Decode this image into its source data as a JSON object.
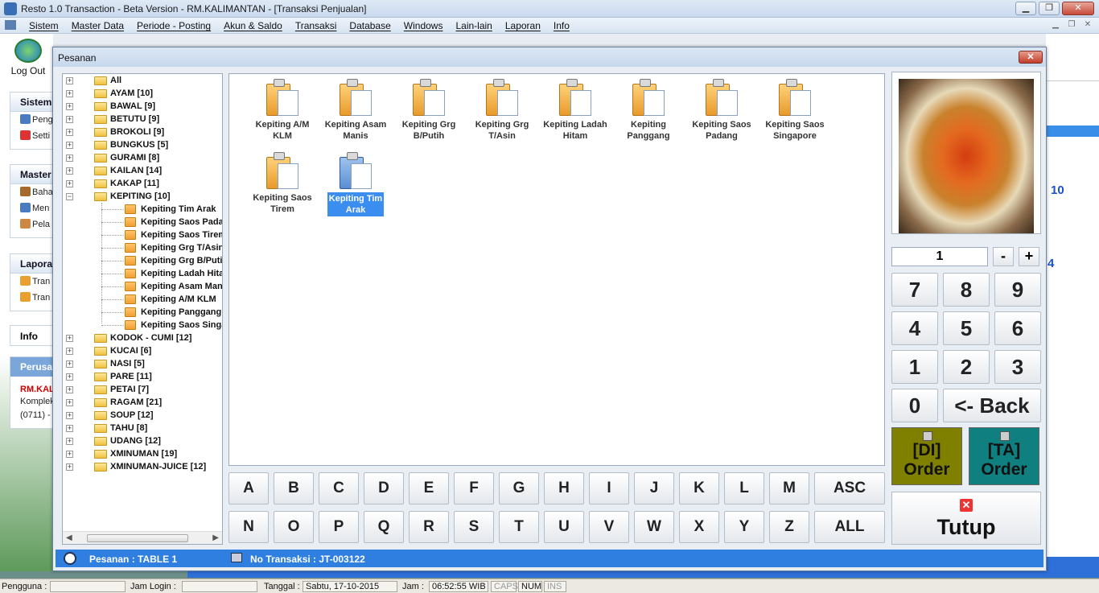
{
  "window": {
    "title": "Resto 1.0 Transaction - Beta Version - RM.KALIMANTAN - [Transaksi Penjualan]"
  },
  "menu": [
    "Sistem",
    "Master Data",
    "Periode - Posting",
    "Akun & Saldo",
    "Transaksi",
    "Database",
    "Windows",
    "Lain-lain",
    "Laporan",
    "Info"
  ],
  "sidebar": {
    "logout_label": "Log Out",
    "sistem": {
      "title": "Sistem",
      "items": [
        "Peng",
        "Setti"
      ]
    },
    "master": {
      "title": "Master",
      "items": [
        "Baha",
        "Men",
        "Pela"
      ]
    },
    "laporan": {
      "title": "Laporan",
      "items": [
        "Tran",
        "Tran"
      ]
    },
    "info_title": "Info",
    "perusahaan": {
      "title": "Perusa",
      "company": "RM.KALIMANTAN",
      "address1": "Komplek",
      "address2": "(0711) -"
    }
  },
  "background_right": {
    "num1": "10",
    "num2": "4"
  },
  "dialog": {
    "title": "Pesanan",
    "close_label": "✕",
    "tree": [
      {
        "label": "All",
        "expanded": false
      },
      {
        "label": "AYAM  [10]"
      },
      {
        "label": "BAWAL  [9]"
      },
      {
        "label": "BETUTU  [9]"
      },
      {
        "label": "BROKOLI  [9]"
      },
      {
        "label": "BUNGKUS  [5]"
      },
      {
        "label": "GURAMI  [8]"
      },
      {
        "label": "KAILAN  [14]"
      },
      {
        "label": "KAKAP  [11]"
      },
      {
        "label": "KEPITING  [10]",
        "expanded": true
      }
    ],
    "tree_children": [
      "Kepiting Tim Arak",
      "Kepiting Saos Padang",
      "Kepiting Saos Tirem",
      "Kepiting Grg T/Asin",
      "Kepiting Grg B/Putih",
      "Kepiting Ladah Hitam",
      "Kepiting Asam Manis",
      "Kepiting A/M KLM",
      "Kepiting Panggang",
      "Kepiting Saos Singapore"
    ],
    "tree_after": [
      "KODOK - CUMI  [12]",
      "KUCAI  [6]",
      "NASI  [5]",
      "PARE  [11]",
      "PETAI  [7]",
      "RAGAM  [21]",
      "SOUP  [12]",
      "TAHU  [8]",
      "UDANG  [12]",
      "XMINUMAN  [19]",
      "XMINUMAN-JUICE  [12]"
    ],
    "menu_items": [
      {
        "line1": "Kepiting A/M",
        "line2": "KLM"
      },
      {
        "line1": "Kepiting Asam",
        "line2": "Manis"
      },
      {
        "line1": "Kepiting Grg",
        "line2": "B/Putih"
      },
      {
        "line1": "Kepiting Grg",
        "line2": "T/Asin"
      },
      {
        "line1": "Kepiting Ladah",
        "line2": "Hitam"
      },
      {
        "line1": "Kepiting",
        "line2": "Panggang"
      },
      {
        "line1": "Kepiting Saos",
        "line2": "Padang"
      },
      {
        "line1": "Kepiting Saos",
        "line2": "Singapore"
      },
      {
        "line1": "Kepiting Saos",
        "line2": "Tirem"
      },
      {
        "line1": "Kepiting Tim",
        "line2": "Arak",
        "selected": true
      }
    ],
    "alpha_row1": [
      "A",
      "B",
      "C",
      "D",
      "E",
      "F",
      "G",
      "H",
      "I",
      "J",
      "K",
      "L",
      "M"
    ],
    "alpha_row2": [
      "N",
      "O",
      "P",
      "Q",
      "R",
      "S",
      "T",
      "U",
      "V",
      "W",
      "X",
      "Y",
      "Z"
    ],
    "asc_label": "ASC",
    "all_label": "ALL",
    "qty": "1",
    "minus_label": "-",
    "plus_label": "+",
    "keypad": [
      "7",
      "8",
      "9",
      "4",
      "5",
      "6",
      "1",
      "2",
      "3"
    ],
    "zero_label": "0",
    "back_label": "<- Back",
    "di_order": {
      "line1": "[DI]",
      "line2": "Order",
      "color": "#7f7f00"
    },
    "ta_order": {
      "line1": "[TA]",
      "line2": "Order",
      "color": "#0f7f7f"
    },
    "tutup_label": "Tutup",
    "status_pesanan": "Pesanan : TABLE 1",
    "status_transaksi": "No Transaksi : JT-003122"
  },
  "statusbar": {
    "pengguna_label": "Pengguna :",
    "jam_login_label": "Jam Login :",
    "tanggal_label": "Tanggal :",
    "tanggal_value": "Sabtu, 17-10-2015",
    "jam_label": "Jam :",
    "jam_value": "06:52:55 WIB",
    "caps": "CAPS",
    "num": "NUM",
    "ins": "INS"
  }
}
